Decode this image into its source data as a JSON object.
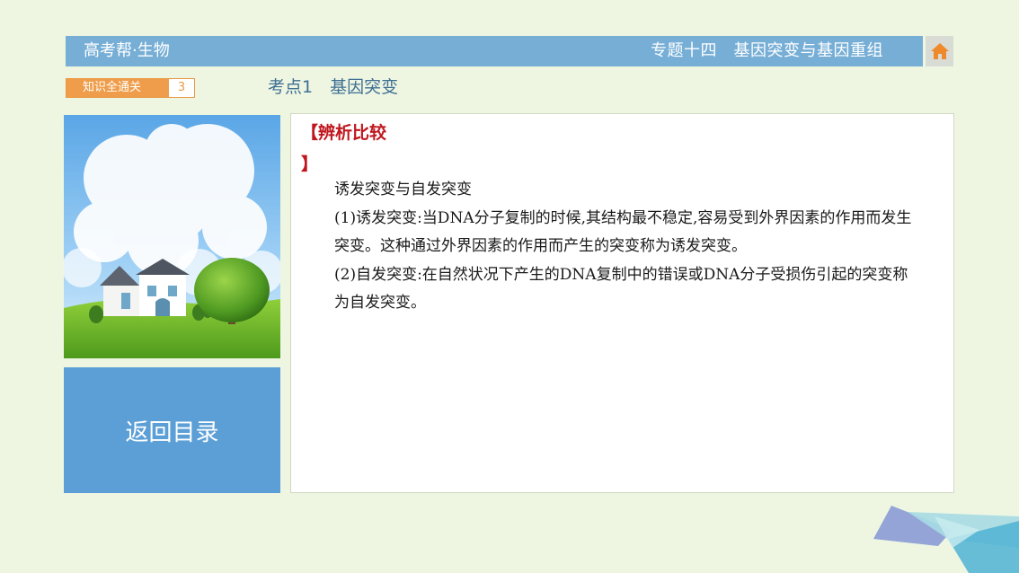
{
  "header": {
    "course": "高考帮·生物",
    "topic": "专题十四　基因突变与基因重组"
  },
  "icons": {
    "home": "home-icon"
  },
  "tag": {
    "label": "知识全通关",
    "number": "3"
  },
  "section_title": "考点1　基因突变",
  "sidebar": {
    "return_label": "返回目录"
  },
  "content": {
    "heading": "【辨析比较",
    "heading_close": "】",
    "lines": [
      "诱发突变与自发突变",
      "(1)诱发突变:当DNA分子复制的时候,其结构最不稳定,容易受到外界因素的作用而发生",
      "突变。这种通过外界因素的作用而产生的突变称为诱发突变。",
      "(2)自发突变:在自然状况下产生的DNA复制中的错误或DNA分子受损伤引起的突变称",
      "为自发突变。"
    ]
  },
  "colors": {
    "header": "#76aed6",
    "accent_orange": "#ef9d4a",
    "return_button": "#5b9fd6",
    "heading_red": "#c0171f",
    "background": "#eef6e2"
  }
}
